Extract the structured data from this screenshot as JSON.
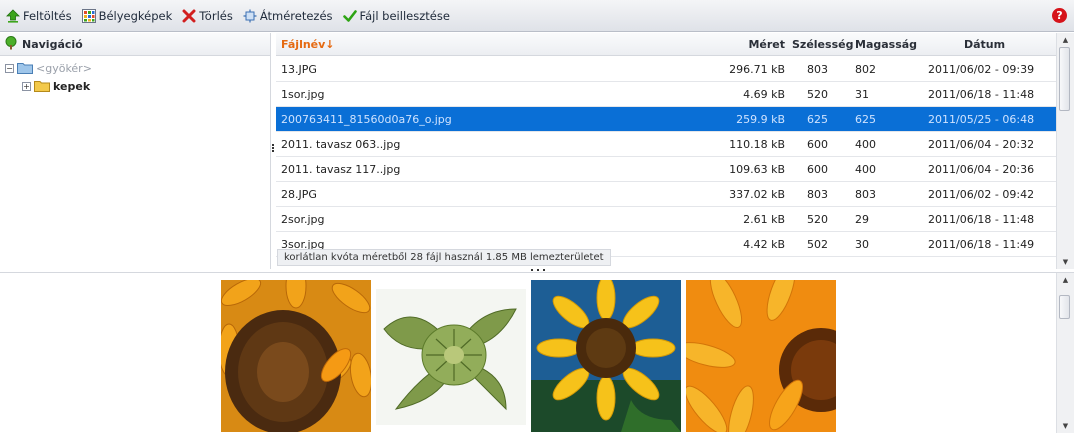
{
  "toolbar": {
    "upload": "Feltöltés",
    "thumbnails": "Bélyegképek",
    "delete": "Törlés",
    "resize": "Átméretezés",
    "insert": "Fájl beillesztése",
    "help": "?"
  },
  "nav": {
    "title": "Navigáció",
    "root": "<gyökér>",
    "folder": "kepek"
  },
  "grid": {
    "headers": {
      "name": "Fájlnév↓",
      "size": "Méret",
      "width": "Szélesség",
      "height": "Magasság",
      "date": "Dátum"
    },
    "rows": [
      {
        "name": "13.JPG",
        "size": "296.71 kB",
        "width": "803",
        "height": "802",
        "date": "2011/06/02 - 09:39"
      },
      {
        "name": "1sor.jpg",
        "size": "4.69 kB",
        "width": "520",
        "height": "31",
        "date": "2011/06/18 - 11:48"
      },
      {
        "name": "200763411_81560d0a76_o.jpg",
        "size": "259.9 kB",
        "width": "625",
        "height": "625",
        "date": "2011/05/25 - 06:48"
      },
      {
        "name": "2011. tavasz 063..jpg",
        "size": "110.18 kB",
        "width": "600",
        "height": "400",
        "date": "2011/06/04 - 20:32"
      },
      {
        "name": "2011. tavasz 117..jpg",
        "size": "109.63 kB",
        "width": "600",
        "height": "400",
        "date": "2011/06/04 - 20:36"
      },
      {
        "name": "28.JPG",
        "size": "337.02 kB",
        "width": "803",
        "height": "803",
        "date": "2011/06/02 - 09:42"
      },
      {
        "name": "2sor.jpg",
        "size": "2.61 kB",
        "width": "520",
        "height": "29",
        "date": "2011/06/18 - 11:48"
      },
      {
        "name": "3sor.jpg",
        "size": "4.42 kB",
        "width": "502",
        "height": "30",
        "date": "2011/06/18 - 11:49"
      }
    ],
    "selected_index": 2
  },
  "status": {
    "quota": "korlátlan kvóta méretből 28 fájl használ 1.85 MB lemezterületet"
  },
  "colors": {
    "selection": "#0a6fd6",
    "sort_header": "#e56a12",
    "help": "#d6131a"
  }
}
